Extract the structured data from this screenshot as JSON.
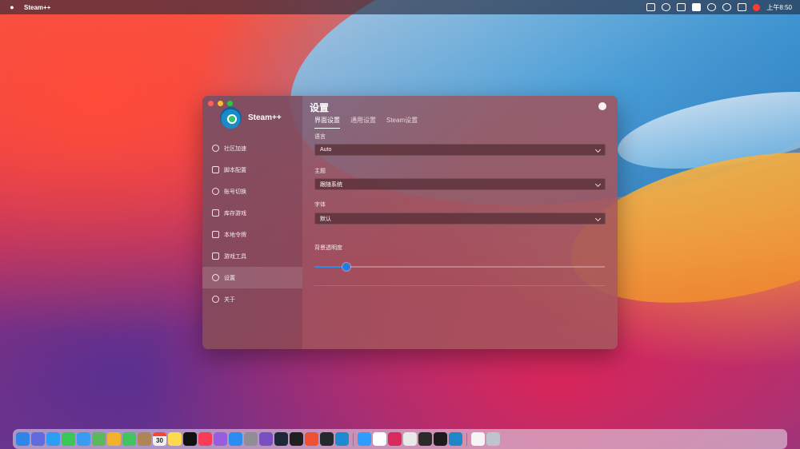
{
  "menubar": {
    "app_name": "Steam++",
    "clock": "上午8:50",
    "icons": [
      "screen-mirroring-icon",
      "moon-icon",
      "window-icon",
      "text-input-icon",
      "wifi-icon",
      "search-icon",
      "control-center-icon",
      "notification-dot-icon"
    ]
  },
  "window": {
    "brand": "Steam++",
    "title": "设置",
    "tabs": [
      {
        "label": "界面设置",
        "active": true
      },
      {
        "label": "通用设置",
        "active": false
      },
      {
        "label": "Steam设置",
        "active": false
      }
    ],
    "nav": [
      {
        "label": "社区加速",
        "icon": "rocket-icon"
      },
      {
        "label": "脚本配置",
        "icon": "script-icon"
      },
      {
        "label": "账号切换",
        "icon": "user-switch-icon"
      },
      {
        "label": "库存游戏",
        "icon": "gamepad-icon"
      },
      {
        "label": "本地令牌",
        "icon": "shield-icon"
      },
      {
        "label": "游戏工具",
        "icon": "toolbox-icon"
      },
      {
        "label": "设置",
        "icon": "settings-icon",
        "active": true
      },
      {
        "label": "关于",
        "icon": "info-icon"
      }
    ],
    "fields": {
      "language": {
        "label": "语言",
        "value": "Auto"
      },
      "theme": {
        "label": "主题",
        "value": "跟随系统"
      },
      "font": {
        "label": "字体",
        "value": "默认"
      },
      "opacity": {
        "label": "背景透明度",
        "value_percent": 11
      }
    }
  },
  "dock": {
    "calendar_day": "30",
    "apps": [
      "finder",
      "launchpad",
      "safari",
      "messages",
      "mail",
      "maps",
      "photos",
      "facetime",
      "contacts",
      "reminders",
      "notes",
      "apple-tv",
      "music",
      "podcasts",
      "app-store",
      "system-preferences",
      "visual-studio",
      "steam",
      "terminal",
      "git",
      "github",
      "vscode",
      "xcode",
      "chrome",
      "rider",
      "settings",
      "terminal-2",
      "instruments",
      "steam-plus-plus",
      "preview",
      "trash"
    ]
  },
  "colors": {
    "accent": "#1f7ee5",
    "close": "#ff5f57",
    "minimize": "#febc2e",
    "zoom": "#28c840"
  }
}
